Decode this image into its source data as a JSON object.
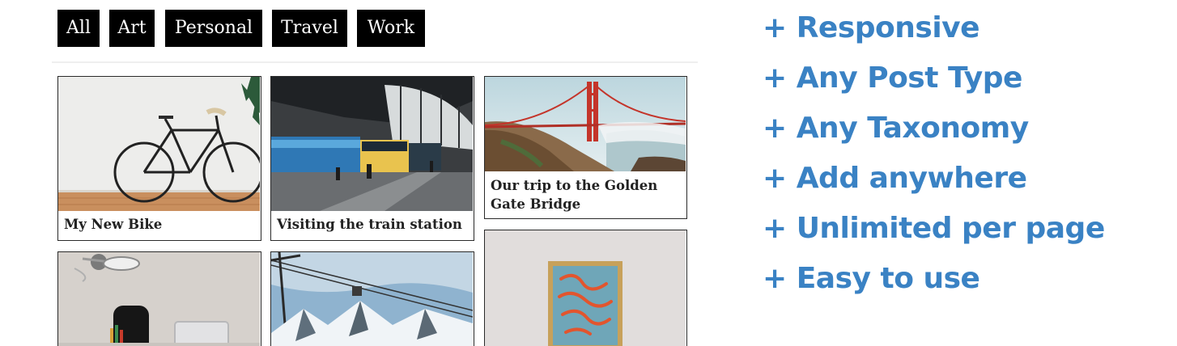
{
  "filters": [
    {
      "label": "All"
    },
    {
      "label": "Art"
    },
    {
      "label": "Personal"
    },
    {
      "label": "Travel"
    },
    {
      "label": "Work"
    }
  ],
  "posts": [
    {
      "caption": "My New Bike",
      "image": "bicycle-photo"
    },
    {
      "caption": "Visiting the train station",
      "image": "train-station-photo"
    },
    {
      "caption": "Our trip to the Golden Gate Bridge",
      "image": "golden-gate-bridge-photo"
    },
    {
      "caption": "",
      "image": "desk-lamp-photo"
    },
    {
      "caption": "",
      "image": "snowy-mountains-cable-car-photo"
    },
    {
      "caption": "",
      "image": "framed-art-photo"
    }
  ],
  "features": [
    {
      "label": "+ Responsive"
    },
    {
      "label": "+ Any Post Type"
    },
    {
      "label": "+ Any Taxonomy"
    },
    {
      "label": "+ Add anywhere"
    },
    {
      "label": "+ Unlimited per page"
    },
    {
      "label": "+ Easy to use"
    }
  ],
  "colors": {
    "accent": "#3a82c4",
    "filter_bg": "#000000",
    "filter_text": "#ffffff"
  }
}
